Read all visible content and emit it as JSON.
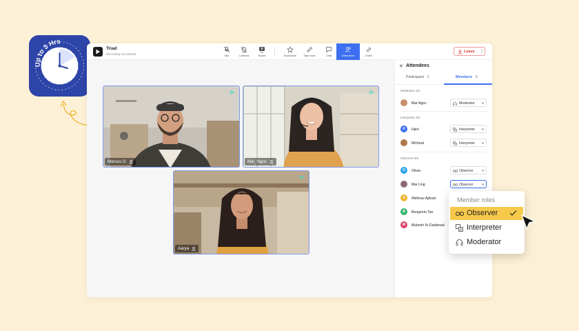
{
  "badge": {
    "text": "Up to 3 Hrs",
    "icon": "clock-icon"
  },
  "app": {
    "title": "Triad",
    "subtitle": "Recording not started",
    "toolbar": [
      {
        "label": "Mic",
        "icon": "mic-off-icon"
      },
      {
        "label": "Camera",
        "icon": "camera-off-icon"
      },
      {
        "label": "Share",
        "icon": "share-icon"
      },
      {
        "label": "Bookmark",
        "icon": "star-icon"
      },
      {
        "label": "Take note",
        "icon": "pencil-icon"
      },
      {
        "label": "Chat",
        "icon": "chat-icon"
      },
      {
        "label": "Attendees",
        "icon": "attendees-icon",
        "active": true
      },
      {
        "label": "Invite",
        "icon": "link-icon"
      }
    ],
    "leave_label": "Leave"
  },
  "videos": [
    {
      "name": "Marcus G"
    },
    {
      "name": "Mai_Ngoc"
    },
    {
      "name": "Aarya"
    }
  ],
  "panel": {
    "title": "Attendees",
    "tabs": [
      {
        "label": "Participant",
        "count": "3"
      },
      {
        "label": "Members",
        "count": "8",
        "active": true
      }
    ],
    "sections": [
      {
        "title": "Moderator 1/3",
        "members": [
          {
            "initial": "",
            "name": "Mai Ngoc",
            "role": "Moderator",
            "color": "#c98e6b"
          }
        ]
      },
      {
        "title": "Interpreter 2/2",
        "members": [
          {
            "initial": "K",
            "name": "Hjerl",
            "role": "Interpreter",
            "color": "#3d6ff0"
          },
          {
            "initial": "",
            "name": "Micheal",
            "role": "Interpreter",
            "color": "#b07a4e"
          }
        ]
      },
      {
        "title": "Observer 5/8",
        "members": [
          {
            "initial": "O",
            "name": "Olivia",
            "role": "Observer",
            "color": "#2aa3e8"
          },
          {
            "initial": "",
            "name": "Mai Ling",
            "role": "Observer",
            "color": "#8a6a70"
          },
          {
            "initial": "A",
            "name": "Abhinav Ajitsari",
            "role": "",
            "color": "#f2b42f"
          },
          {
            "initial": "B",
            "name": "Benjamin Tan",
            "role": "",
            "color": "#34b36b"
          },
          {
            "initial": "M",
            "name": "Mukesh Kr.Dadarwal",
            "role": "",
            "color": "#e0436b"
          }
        ]
      }
    ]
  },
  "role_menu": {
    "header": "Member roles",
    "items": [
      {
        "label": "Observer",
        "selected": true
      },
      {
        "label": "Interpreter"
      },
      {
        "label": "Moderator"
      }
    ]
  },
  "colors": {
    "accent": "#3d6ff0",
    "badge": "#2d44a8",
    "background": "#fcf1d6",
    "highlight": "#f6c94b",
    "leave": "#d63333"
  }
}
